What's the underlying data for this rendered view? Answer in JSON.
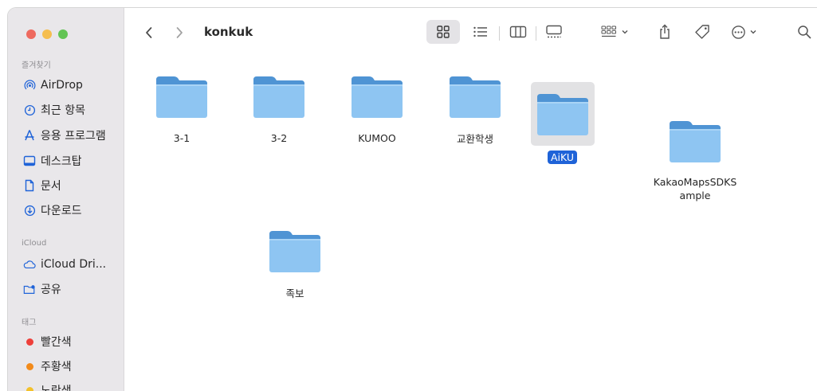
{
  "window": {
    "title": "konkuk"
  },
  "sidebar": {
    "favorites_header": "즐겨찾기",
    "favorites": [
      {
        "label": "AirDrop",
        "icon": "airdrop-icon"
      },
      {
        "label": "최근 항목",
        "icon": "clock-icon"
      },
      {
        "label": "응용 프로그램",
        "icon": "applications-icon"
      },
      {
        "label": "데스크탑",
        "icon": "desktop-icon"
      },
      {
        "label": "문서",
        "icon": "document-icon"
      },
      {
        "label": "다운로드",
        "icon": "download-icon"
      }
    ],
    "icloud_header": "iCloud",
    "icloud": [
      {
        "label": "iCloud Dri...",
        "icon": "cloud-icon"
      },
      {
        "label": "공유",
        "icon": "shared-folder-icon"
      }
    ],
    "tags_header": "태그",
    "tags": [
      {
        "label": "빨간색",
        "color": "#ee3f3a"
      },
      {
        "label": "주황색",
        "color": "#f28a1a"
      },
      {
        "label": "노란색",
        "color": "#f3c12b"
      }
    ]
  },
  "accent_color": "#1f63d8",
  "folder_color": "#8ec5f2",
  "folders": [
    {
      "name": "3-1"
    },
    {
      "name": "3-2"
    },
    {
      "name": "KUMOO"
    },
    {
      "name": "교환학생"
    },
    {
      "name": "AiKU",
      "selected": true
    },
    {
      "name": "KakaoMapsSDKS",
      "name2": "ample"
    },
    {
      "name": "족보"
    }
  ]
}
